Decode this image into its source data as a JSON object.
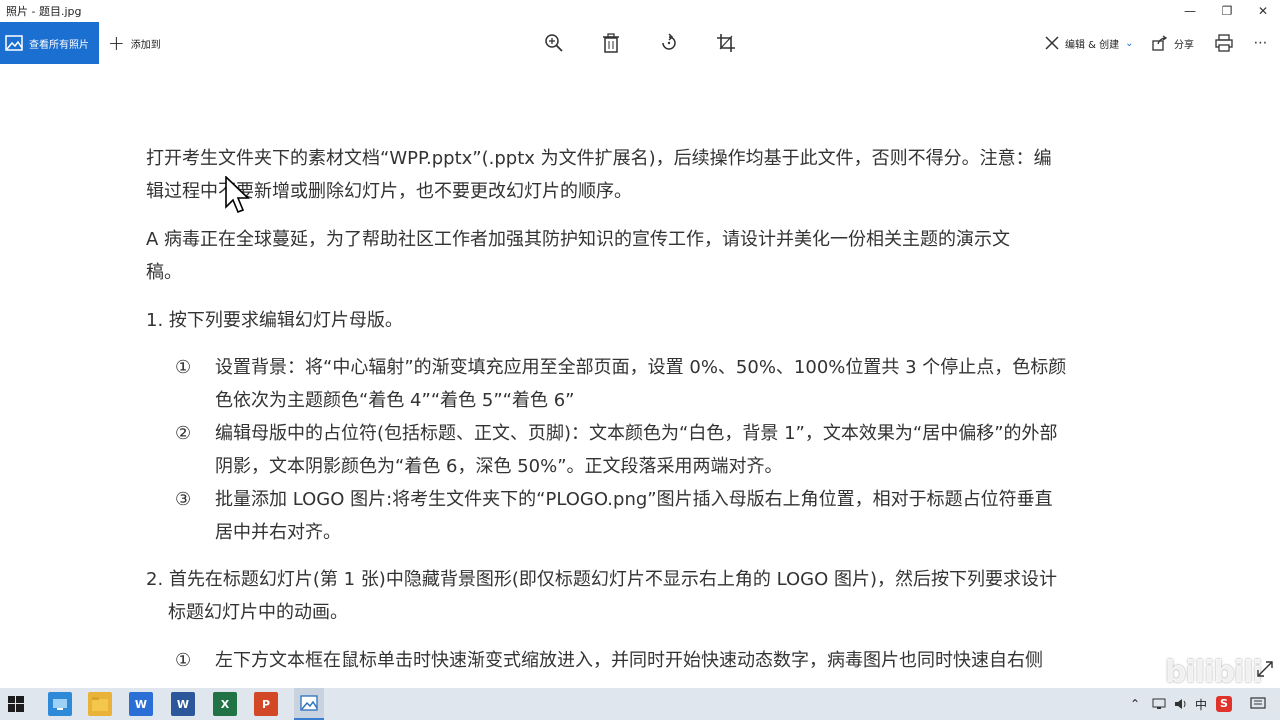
{
  "window": {
    "title": "照片 - 题目.jpg"
  },
  "toolbar": {
    "all_photos": "查看所有照片",
    "add_to": "添加到",
    "edit_create": "编辑 & 创建",
    "share": "分享"
  },
  "document": {
    "line1": "打开考生文件夹下的素材文档“WPP.pptx”(.pptx 为文件扩展名)，后续操作均基于此文件，否则不得分。注意：编",
    "line2": "辑过程中不要新增或删除幻灯片，也不要更改幻灯片的顺序。",
    "line3": "A 病毒正在全球蔓延，为了帮助社区工作者加强其防护知识的宣传工作，请设计并美化一份相关主题的演示文",
    "line4": "稿。",
    "item1": "1. 按下列要求编辑幻灯片母版。",
    "sub1_num": "①",
    "sub1_l1": "设置背景：将“中心辐射”的渐变填充应用至全部页面，设置 0%、50%、100%位置共 3 个停止点，色标颜",
    "sub1_l2": "色依次为主题颜色“着色 4”“着色 5”“着色 6”",
    "sub2_num": "②",
    "sub2_l1": "编辑母版中的占位符(包括标题、正文、页脚)：文本颜色为“白色，背景 1”，文本效果为“居中偏移”的外部",
    "sub2_l2": "阴影，文本阴影颜色为“着色 6，深色 50%”。正文段落采用两端对齐。",
    "sub3_num": "③",
    "sub3_l1": "批量添加 LOGO 图片:将考生文件夹下的“PLOGO.png”图片插入母版右上角位置，相对于标题占位符垂直",
    "sub3_l2": "居中并右对齐。",
    "item2_l1": "2. 首先在标题幻灯片(第 1 张)中隐藏背景图形(即仅标题幻灯片不显示右上角的 LOGO 图片)，然后按下列要求设计",
    "item2_l2": "标题幻灯片中的动画。",
    "sub4_num": "①",
    "sub4_l1": "左下方文本框在鼠标单击时快速渐变式缩放进入，并同时开始快速动态数字，病毒图片也同时快速自右侧"
  },
  "taskbar": {
    "ime": "中",
    "word": "W",
    "excel": "X",
    "ppt": "P",
    "wps": "W"
  },
  "watermark": "bilibili"
}
